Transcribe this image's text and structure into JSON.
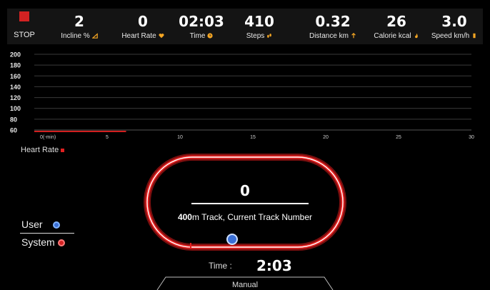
{
  "top_bar": {
    "stop_label": "STOP",
    "stats": [
      {
        "key": "incline",
        "value": "2",
        "label": "Incline %",
        "icon": "incline-icon"
      },
      {
        "key": "heart_rate",
        "value": "0",
        "label": "Heart Rate",
        "icon": "heart-icon"
      },
      {
        "key": "time",
        "value": "02:03",
        "label": "Time",
        "icon": "clock-icon"
      },
      {
        "key": "steps",
        "value": "410",
        "label": "Steps",
        "icon": "footsteps-icon"
      },
      {
        "key": "distance",
        "value": "0.32",
        "label": "Distance km",
        "icon": "distance-icon"
      },
      {
        "key": "calorie",
        "value": "26",
        "label": "Calorie kcal",
        "icon": "flame-icon"
      },
      {
        "key": "speed",
        "value": "3.0",
        "label": "Speed km/h",
        "icon": "speed-icon"
      }
    ]
  },
  "chart_data": {
    "type": "line",
    "y_ticks": [
      "200",
      "180",
      "160",
      "140",
      "120",
      "100",
      "80",
      "60"
    ],
    "x_ticks": [
      "0(-min)",
      "5",
      "10",
      "15",
      "20",
      "25",
      "30"
    ],
    "ylim": [
      60,
      200
    ],
    "xlim": [
      0,
      30
    ],
    "series": [
      {
        "name": "Heart Rate",
        "color": "#d11f1f",
        "x": [
          0,
          6.3
        ],
        "y": [
          60,
          60
        ]
      }
    ],
    "grid": true
  },
  "heart_rate_legend": "Heart Rate",
  "track": {
    "count": "0",
    "caption_bold": "400",
    "caption_rest": "m Track, Current Track Number",
    "progress": 0.5
  },
  "legend": {
    "user": "User",
    "system": "System"
  },
  "bottom": {
    "time_label": "Time :",
    "time_value": "2:03",
    "mode": "Manual"
  },
  "colors": {
    "accent_red": "#d32222",
    "track_red": "#e52020",
    "user_blue": "#3a6fd6",
    "icon_orange": "#f5a623"
  }
}
